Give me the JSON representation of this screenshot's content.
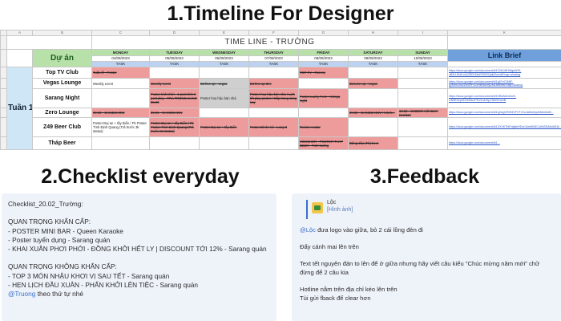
{
  "titles": {
    "timeline": "1.Timeline For Designer",
    "checklist": "2.Checklist everyday",
    "feedback": "3.Feedback"
  },
  "sheet": {
    "col_headers": [
      "",
      "A",
      "B",
      "C",
      "D",
      "E",
      "F",
      "G",
      "H",
      "I",
      "J",
      "K"
    ],
    "title": "TIME LINE - TRƯỜNG",
    "project_header": "Dự án",
    "link_header": "Link Brief",
    "week_label": "Tuần 1",
    "days": [
      "MONDAY",
      "TUESDAY",
      "WEDNESDAY",
      "THURSDAY",
      "FRIDAY",
      "SATURDAY",
      "SUNDAY"
    ],
    "dates": [
      "04/09/2023",
      "05/09/2023",
      "06/09/2023",
      "07/09/2023",
      "08/09/2023",
      "09/09/2023",
      "10/09/2023"
    ],
    "task_label": "TASK",
    "rows": [
      {
        "club": "Top TV Club",
        "row_no": "",
        "cells": [
          "Tuần lễ - Poster",
          "",
          "",
          "",
          "TOP TV - Tommy",
          "",
          ""
        ],
        "link": "https://docs.google.com/document/d/1CMLMEhHgaWVt-uB9i1JKdKmQ3EEHDfcE5GEIQaiiWvredit?usp=sharing"
      },
      {
        "club": "Vegas Lounge",
        "row_no": "",
        "cells": [
          "Weekly event",
          "Weekly event",
          "DJ line up - vegas",
          "DJ line up dec",
          "",
          "DJ Line up - vegas",
          ""
        ],
        "link": "https://docs.google.com/document/d/1g57eC3MiF-jQE89Gu42ZnSHFSCtHzmdJ9yDMLxMmb6?usp=sharing"
      },
      {
        "club": "Sarang Night",
        "row_no": "",
        "cells": [
          "",
          "Poster tính khởi - 1 post tính 3 post play - TRA TRONG SANG 05.09",
          "Poster hoa hậu bán nhà",
          "Poster hoa hậu bán nhà / Lịch tết play poster / Sắp trang sáng nay",
          "Poster Lucky Fest - Kinoga night",
          "",
          ""
        ],
        "link": "https://docs.google.com/document/d/1VBd3dmZvdX-CB9R2ZyKDVDINroPKV2u4rHpC5b2Hrxedit"
      },
      {
        "club": "Zero Lounge",
        "row_no": "",
        "cells": [
          "09.09 - GAMESHOW",
          "09.09 - GAMESHOW",
          "",
          "",
          "",
          "09.09 - GAMESHOW / Hành...",
          "10.09 - SINDER VỚI DUY KHÁNH"
        ],
        "link": "https://docs.google.com/document/d/1qI4vgVfV5t3VFVT1SuJaDdebyeMdmlekM..."
      },
      {
        "club": "Z49 Beer Club",
        "row_no": "",
        "cells": [
          "Poster Đại an + tầy Biển / Fb Poster Tình Định Quang (Trả trước 3k status)",
          "Poster Đại an + tầy Biển / Fb Poster Tình Định Quang (Trả trước 34 status)",
          "Poster Đại an + tầy Biển",
          "Poster Đình Hỏi - Long 3",
          "Resize Avatar",
          "",
          ""
        ],
        "link": "https://docs.google.com/document/d/1XXVKTbtFdgNeHDvrU4e6tNDCuhNSD8Ax6f16t..."
      },
      {
        "club": "Tháp Beer",
        "row_no": "",
        "cells": [
          "",
          "",
          "",
          "",
          "VOUCHER - POSTER THÁP BEER - Tình huống",
          "Đăng dấu (Fb) beer",
          ""
        ],
        "link": "https://docs.google.com/document/d/1..."
      }
    ]
  },
  "checklist": {
    "heading": "Checklist_20.02_Trường:",
    "urgent_title": "QUAN TRỌNG KHẨN CẤP:",
    "urgent_items": [
      "- POSTER MINI BAR - Queen Karaoke",
      "- Poster tuyển dụng - Sarang quán",
      "- KHAI XUÂN PHƠI PHỚI - ĐỒNG KHỞI HẾT LY | DISCOUNT TỚI 12% - Sarang quán"
    ],
    "nonurgent_title": "QUAN TRỌNG KHÔNG KHẨN CẤP:",
    "nonurgent_items": [
      "- TOP 3 MÓN NHẬU KHƠI VỊ SAU TẾT - Sarang quán",
      "- HẸN LỊCH ĐẦU XUÂN - PHẤN KHỞI LÊN TIỆC - Sarang quán"
    ],
    "mention": "@Truong",
    "footer_rest": " theo thứ tự nhé"
  },
  "feedback": {
    "quote_name": "Lộc",
    "quote_text": "[Hình ảnh]",
    "mention": "@Lộc",
    "line1_rest": " đưa logo vào giữa, bỏ 2 cái lồng đèn đi",
    "line2": "Đẩy cánh mai lên trên",
    "line3a": "Text tết nguyên đán to lên để ở giữa nhưng hãy viết câu kiểu \"Chúc mừng năm mới\" chữ",
    "line3b": "đừng để 2 câu kia",
    "line4a": "Hotline nằm trên địa chỉ kéo lên trên",
    "line4b": "Tùi gửi fback để clear hơn",
    "colors": {
      "accent": "#3a6fc9",
      "panel_bg": "#eef3fa"
    }
  }
}
